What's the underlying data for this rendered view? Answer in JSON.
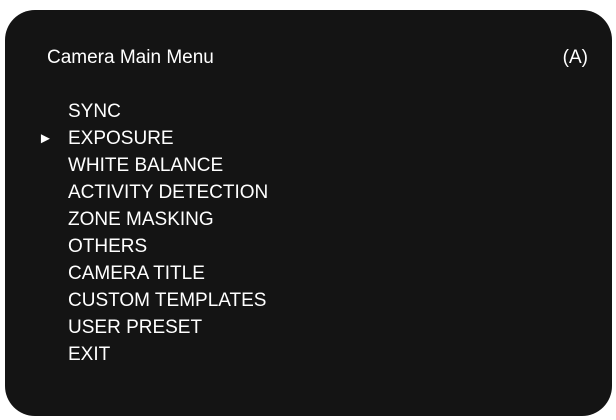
{
  "header": {
    "title": "Camera Main Menu",
    "mode": "(A)"
  },
  "cursor": {
    "icon": "right-pointing-triangle",
    "glyph": "►",
    "selected_index": 1
  },
  "menu": {
    "items": [
      {
        "label": "SYNC"
      },
      {
        "label": "EXPOSURE"
      },
      {
        "label": "WHITE BALANCE"
      },
      {
        "label": "ACTIVITY DETECTION"
      },
      {
        "label": "ZONE MASKING"
      },
      {
        "label": "OTHERS"
      },
      {
        "label": "CAMERA TITLE"
      },
      {
        "label": "CUSTOM TEMPLATES"
      },
      {
        "label": "USER PRESET"
      },
      {
        "label": "EXIT"
      }
    ]
  },
  "colors": {
    "background": "#141414",
    "text": "#ffffff"
  }
}
